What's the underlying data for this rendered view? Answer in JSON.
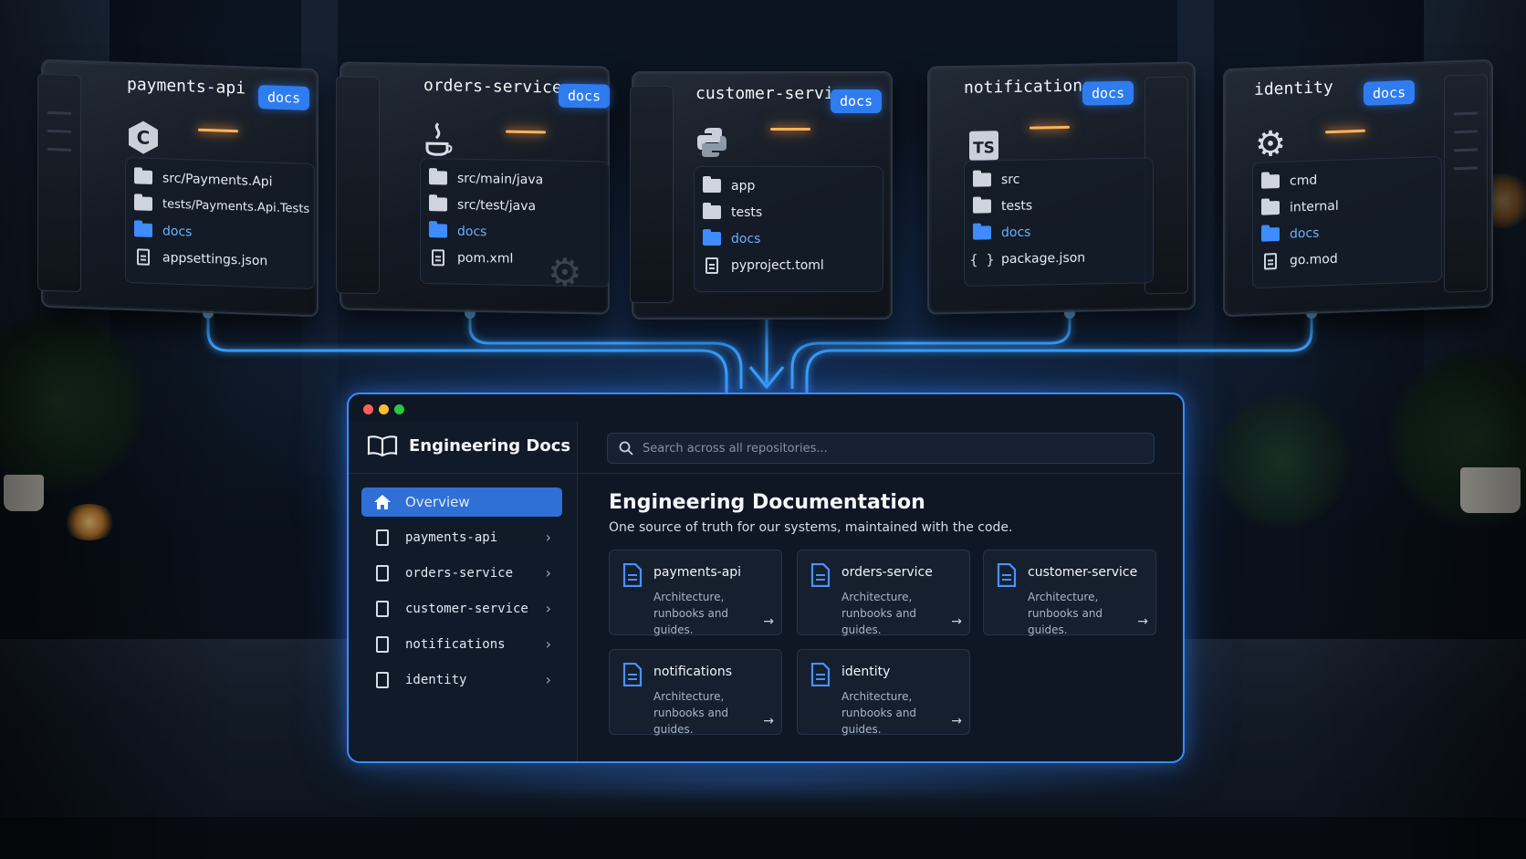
{
  "repos": [
    {
      "name": "payments-api",
      "badge": "docs",
      "language_icon": "csharp-icon",
      "tree": [
        {
          "label": "src/Payments.Api",
          "icon": "folder-icon"
        },
        {
          "label": "tests/Payments.Api.Tests",
          "icon": "folder-icon"
        },
        {
          "label": "docs",
          "icon": "folder-blue-icon"
        },
        {
          "label": "appsettings.json",
          "icon": "file-icon"
        }
      ]
    },
    {
      "name": "orders-service",
      "badge": "docs",
      "language_icon": "java-icon",
      "tree": [
        {
          "label": "src/main/java",
          "icon": "folder-icon"
        },
        {
          "label": "src/test/java",
          "icon": "folder-icon"
        },
        {
          "label": "docs",
          "icon": "folder-blue-icon"
        },
        {
          "label": "pom.xml",
          "icon": "file-icon"
        }
      ]
    },
    {
      "name": "customer-service",
      "badge": "docs",
      "language_icon": "python-icon",
      "tree": [
        {
          "label": "app",
          "icon": "folder-icon"
        },
        {
          "label": "tests",
          "icon": "folder-icon"
        },
        {
          "label": "docs",
          "icon": "folder-blue-icon"
        },
        {
          "label": "pyproject.toml",
          "icon": "file-icon"
        }
      ]
    },
    {
      "name": "notifications",
      "badge": "docs",
      "language_icon": "typescript-icon",
      "language_text": "TS",
      "tree": [
        {
          "label": "src",
          "icon": "folder-icon"
        },
        {
          "label": "tests",
          "icon": "folder-icon"
        },
        {
          "label": "docs",
          "icon": "folder-blue-icon"
        },
        {
          "label": "package.json",
          "icon": "braces-icon"
        }
      ]
    },
    {
      "name": "identity",
      "badge": "docs",
      "language_icon": "gear-icon",
      "tree": [
        {
          "label": "cmd",
          "icon": "folder-icon"
        },
        {
          "label": "internal",
          "icon": "folder-icon"
        },
        {
          "label": "docs",
          "icon": "folder-blue-icon"
        },
        {
          "label": "go.mod",
          "icon": "file-icon"
        }
      ]
    }
  ],
  "app": {
    "brand": "Engineering Docs",
    "search_placeholder": "Search across all repositories...",
    "nav": [
      {
        "label": "Overview",
        "active": true,
        "icon": "home-icon"
      },
      {
        "label": "payments-api",
        "icon": "document-icon"
      },
      {
        "label": "orders-service",
        "icon": "document-icon"
      },
      {
        "label": "customer-service",
        "icon": "document-icon"
      },
      {
        "label": "notifications",
        "icon": "document-icon"
      },
      {
        "label": "identity",
        "icon": "document-icon"
      }
    ],
    "title": "Engineering Documentation",
    "subtitle": "One source of truth for our systems, maintained with the code.",
    "cards": [
      {
        "title": "payments-api",
        "desc": "Architecture, runbooks and guides."
      },
      {
        "title": "orders-service",
        "desc": "Architecture, runbooks and guides."
      },
      {
        "title": "customer-service",
        "desc": "Architecture, runbooks and guides."
      },
      {
        "title": "notifications",
        "desc": "Architecture, runbooks and guides."
      },
      {
        "title": "identity",
        "desc": "Architecture, runbooks and guides."
      }
    ]
  },
  "colors": {
    "accent": "#2f7cf0",
    "connector": "#3aa0ff",
    "window_red": "#ff5f57",
    "window_yellow": "#febc2e",
    "window_green": "#28c840"
  }
}
